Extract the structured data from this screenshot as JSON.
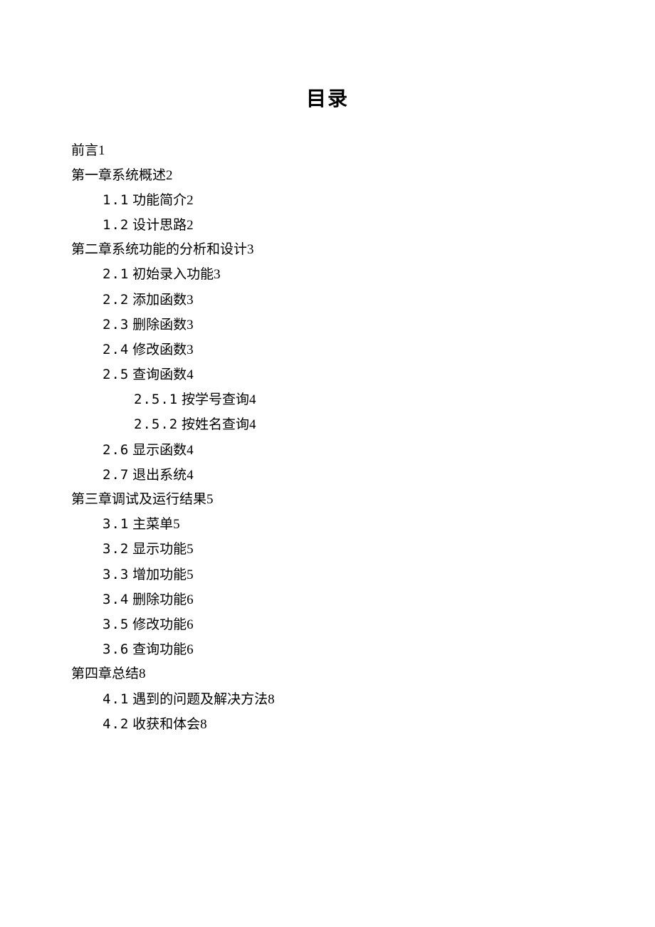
{
  "title": "目录",
  "entries": [
    {
      "level": 0,
      "num": "",
      "text": "前言",
      "page": "1"
    },
    {
      "level": 0,
      "num": "",
      "text": "第一章系统概述",
      "page": "2"
    },
    {
      "level": 1,
      "num": "1.1",
      "text": "功能简介",
      "page": "2"
    },
    {
      "level": 1,
      "num": "1.2",
      "text": "设计思路",
      "page": "2"
    },
    {
      "level": 0,
      "num": "",
      "text": "第二章系统功能的分析和设计",
      "page": "3"
    },
    {
      "level": 1,
      "num": "2.1",
      "text": "初始录入功能",
      "page": "3"
    },
    {
      "level": 1,
      "num": "2.2",
      "text": "添加函数",
      "page": "3"
    },
    {
      "level": 1,
      "num": "2.3",
      "text": "删除函数",
      "page": "3"
    },
    {
      "level": 1,
      "num": "2.4",
      "text": "修改函数",
      "page": "3"
    },
    {
      "level": 1,
      "num": "2.5",
      "text": "查询函数",
      "page": "4"
    },
    {
      "level": 2,
      "num": "2.5.1",
      "text": "按学号查询",
      "page": "4"
    },
    {
      "level": 2,
      "num": "2.5.2",
      "text": "按姓名查询",
      "page": "4"
    },
    {
      "level": 1,
      "num": "2.6",
      "text": "显示函数",
      "page": "4"
    },
    {
      "level": 1,
      "num": "2.7",
      "text": "退出系统",
      "page": "4"
    },
    {
      "level": 0,
      "num": "",
      "text": "第三章调试及运行结果",
      "page": "5"
    },
    {
      "level": 1,
      "num": "3.1",
      "text": "主菜单",
      "page": "5"
    },
    {
      "level": 1,
      "num": "3.2",
      "text": "显示功能",
      "page": "5"
    },
    {
      "level": 1,
      "num": "3.3",
      "text": "增加功能",
      "page": "5"
    },
    {
      "level": 1,
      "num": "3.4",
      "text": "删除功能",
      "page": "6"
    },
    {
      "level": 1,
      "num": "3.5",
      "text": "修改功能",
      "page": "6"
    },
    {
      "level": 1,
      "num": "3.6",
      "text": "查询功能",
      "page": "6"
    },
    {
      "level": 0,
      "num": "",
      "text": "第四章总结",
      "page": "8"
    },
    {
      "level": 1,
      "num": "4.1",
      "text": "遇到的问题及解决方法",
      "page": "8"
    },
    {
      "level": 1,
      "num": "4.2",
      "text": "收获和体会",
      "page": "8"
    }
  ]
}
